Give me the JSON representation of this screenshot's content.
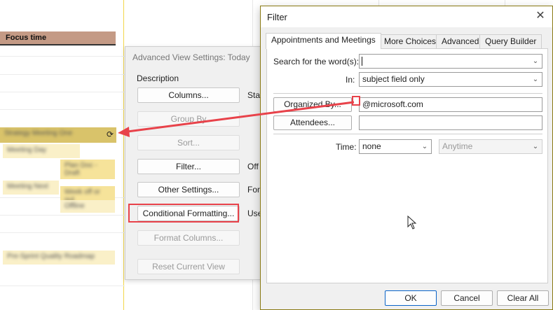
{
  "calendar": {
    "focus_label": "Focus time",
    "blurred_items": [
      "Strategy Meeting One",
      "Meeting Day",
      "Plan Doc - Draft",
      "Meeting Next",
      "Week off or out",
      "Offline",
      "Pre-Sprint Quality Roadmap"
    ]
  },
  "advanced_view": {
    "title": "Advanced View Settings: Today",
    "section_label": "Description",
    "buttons": [
      "Columns...",
      "Group By",
      "Sort...",
      "Filter...",
      "Other Settings...",
      "Conditional Formatting...",
      "Format Columns...",
      "Reset Current View"
    ],
    "side_labels": [
      "Star",
      "Off",
      "Fon",
      "Use"
    ]
  },
  "filter_dialog": {
    "title": "Filter",
    "tabs": [
      "Appointments and Meetings",
      "More Choices",
      "Advanced",
      "Query Builder"
    ],
    "search_label": "Search for the word(s):",
    "search_value": "",
    "in_label": "In:",
    "in_value": "subject field only",
    "organized_by_button": "Organized By...",
    "organized_by_value": "@microsoft.com",
    "attendees_button": "Attendees...",
    "attendees_value": "",
    "time_label": "Time:",
    "time_value": "none",
    "time_range_value": "Anytime",
    "ok_label": "OK",
    "cancel_label": "Cancel",
    "clear_all_label": "Clear All"
  },
  "colors": {
    "focus_block": "#c49a85",
    "appointment_yellow": "#f6e39a",
    "annotation_red": "#e8424a",
    "dialog_border": "#8a7a14"
  }
}
